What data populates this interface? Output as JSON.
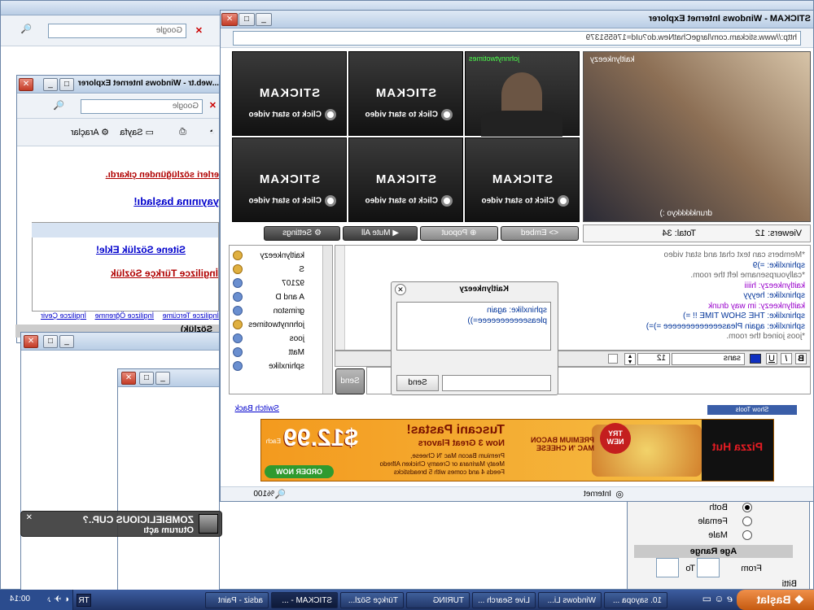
{
  "background_window": {
    "search_placeholder": "Google"
  },
  "ie_left": {
    "title": "...web.tr - Windows Internet Explorer",
    "search_placeholder": "Google",
    "page_menu": "Sayfa",
    "tools_menu": "Araçlar",
    "text_removed": "erleri sözlüğünden çıkardı.",
    "text_started": "yayınına başladı!",
    "link_add": "Sitene Sözlük Ekle!",
    "link_english": "İngilizce Türkçe Sözlük",
    "footer_links": [
      "İngilizce Tercüme",
      "İngilizce Öğrenme",
      "İngilizce Çevir"
    ],
    "heading_fragment": "Sözlük)"
  },
  "stickam": {
    "title": "STICKAM - Windows Internet Explorer",
    "url": "http://www.stickam.com/largeChatNew.do?uId=176551379",
    "cam_logo": "STICKAM",
    "cam_cta": "Click to start video",
    "cam_johnny_label": "johnnytwotimes",
    "cam_main_label": "kaitlynkeezy",
    "cam_main_tag": "drunkkkkkyo :)",
    "viewers": "Viewers: 12",
    "total": "Total: 34",
    "btn_embed": "Embed",
    "btn_popout": "Popout",
    "btn_mute": "Mute All",
    "btn_settings": "Settings",
    "users": [
      "kaitlynkeezy",
      "S",
      "92107",
      "A and D",
      "grimston",
      "johnnytwotimes",
      "joos",
      "Matt",
      "sphinxlike"
    ],
    "chat": [
      "*Members can text chat and start video",
      "sphinxlike: =)9",
      "*callyourpsename left the room.",
      "kaitlynkeezy: hiiii",
      "sphinxlike: heyyy",
      "kaitlynkeezy: im way drunk",
      "sphinxlike: THE SHOW TIME !! =)",
      "sphinxlike: again Pleaseeeeeeeeeeeee =)=)",
      "*joos joined the room."
    ],
    "font_name": "sans",
    "font_size": "12",
    "send_label": "Send",
    "switch_back": "Switch Back",
    "show_tools": "Show Tools",
    "pm_title": "Kaitlynkeezy",
    "pm_lines": [
      "sphinxlike: again",
      "pleaseeeeeeeeeee=))"
    ],
    "pm_send": "Send",
    "status_zone": "Internet",
    "zoom": "%100",
    "ad": {
      "headline": "Tuscani Pastas!",
      "sub": "Now 3 Great Flavors",
      "price": "$12.99",
      "price_note": "Each",
      "badge": "TRY NEW",
      "banner": "PREMIUM BACON MAC 'N CHEESE",
      "desc1": "Premium Bacon Mac 'N Cheese,",
      "desc2": "Meaty Marinara or Creamy Chicken Alfredo",
      "desc3": "Feeds 4 and comes with 5 breadsticks",
      "order": "ORDER NOW",
      "brand": "Pizza Hut"
    }
  },
  "side_panel": {
    "both": "Both",
    "female": "Female",
    "male": "Male",
    "age_range": "Age Range",
    "from": "From",
    "to": "To",
    "status": "Bitti"
  },
  "notification": {
    "name": "ZOMBIELICIOUS CUP..?",
    "message": "Oturum açtı"
  },
  "taskbar": {
    "start": "Başlat",
    "items": [
      "10. sayopa ...",
      "Windows Li...",
      "Live Search ...",
      "TURING",
      "Türkçe Sözl...",
      "STICKAM - ...",
      "adsiz - Paint"
    ],
    "lang": "TR",
    "clock": "00:14"
  },
  "colors": {
    "title_blue": "#b9cde5",
    "taskbar": "#23386a",
    "start_green": "#e6792a"
  }
}
